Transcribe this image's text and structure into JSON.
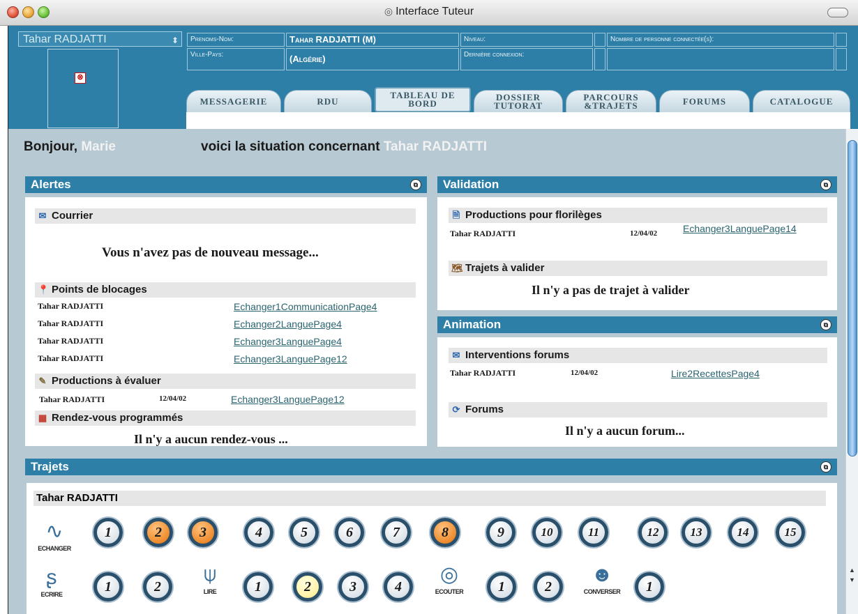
{
  "window": {
    "title": "Interface Tuteur"
  },
  "header": {
    "user_select": "Tahar RADJATTI",
    "labels": {
      "prenoms_nom": "Prenoms-Nom:",
      "ville_pays": "Ville-Pays:",
      "niveau": "Niveau:",
      "derniere_connexion": "Dernière connexion:",
      "nombre_connectees": "Nombre de personne connectée(s):"
    },
    "values": {
      "prenoms_nom": "Tahar RADJATTI (M)",
      "ville_pays": "(Algérie)"
    }
  },
  "tabs": [
    {
      "label": "MESSAGERIE"
    },
    {
      "label": "RDU"
    },
    {
      "label": "TABLEAU DE BORD",
      "active": true
    },
    {
      "label": "DOSSIER TUTORAT"
    },
    {
      "label": "PARCOURS &TRAJETS"
    },
    {
      "label": "FORUMS"
    },
    {
      "label": "CATALOGUE"
    }
  ],
  "greeting": {
    "bonjour": "Bonjour,",
    "tutor": "Marie",
    "situation": "voici la situation concernant",
    "student": "Tahar RADJATTI"
  },
  "alertes": {
    "title": "Alertes",
    "courrier": {
      "title": "Courrier",
      "message": "Vous n'avez pas de nouveau message..."
    },
    "blocages": {
      "title": "Points de blocages",
      "rows": [
        {
          "name": "Tahar RADJATTI",
          "link": "Echanger1CommunicationPage4"
        },
        {
          "name": "Tahar RADJATTI",
          "link": "Echanger2LanguePage4"
        },
        {
          "name": "Tahar RADJATTI",
          "link": "Echanger3LanguePage4"
        },
        {
          "name": "Tahar RADJATTI",
          "link": "Echanger3LanguePage12"
        }
      ]
    },
    "productions": {
      "title": "Productions à évaluer",
      "rows": [
        {
          "name": "Tahar RADJATTI",
          "date": "12/04/02",
          "link": "Echanger3LanguePage12"
        }
      ]
    },
    "rendezvous": {
      "title": "Rendez-vous programmés",
      "message": "Il n'y a aucun rendez-vous ..."
    }
  },
  "validation": {
    "title": "Validation",
    "florileges": {
      "title": "Productions pour florilèges",
      "rows": [
        {
          "name": "Tahar RADJATTI",
          "date": "12/04/02",
          "link": "Echanger3LanguePage14"
        }
      ]
    },
    "trajets": {
      "title": "Trajets à valider",
      "message": "Il n'y a pas de trajet à valider"
    }
  },
  "animation": {
    "title": "Animation",
    "interventions": {
      "title": "Interventions forums",
      "rows": [
        {
          "name": "Tahar RADJATTI",
          "date": "12/04/02",
          "link": "Lire2RecettesPage4"
        }
      ]
    },
    "forums": {
      "title": "Forums",
      "message": "Il n'y a aucun forum..."
    }
  },
  "trajets": {
    "title": "Trajets",
    "student": "Tahar RADJATTI",
    "skills": {
      "echanger": "ECHANGER",
      "ecrire": "ECRIRE",
      "lire": "LIRE",
      "ecouter": "ECOUTER",
      "converser": "CONVERSER"
    },
    "row1": [
      {
        "n": "1",
        "state": "normal"
      },
      {
        "n": "2",
        "state": "orange"
      },
      {
        "n": "3",
        "state": "orange"
      },
      {
        "n": "4",
        "state": "normal"
      },
      {
        "n": "5",
        "state": "normal"
      },
      {
        "n": "6",
        "state": "normal"
      },
      {
        "n": "7",
        "state": "normal"
      },
      {
        "n": "8",
        "state": "orange"
      },
      {
        "n": "9",
        "state": "normal"
      },
      {
        "n": "10",
        "state": "normal"
      },
      {
        "n": "11",
        "state": "normal"
      },
      {
        "n": "12",
        "state": "normal"
      },
      {
        "n": "13",
        "state": "normal"
      },
      {
        "n": "14",
        "state": "normal"
      },
      {
        "n": "15",
        "state": "normal"
      }
    ],
    "ecrire_steps": [
      {
        "n": "1",
        "state": "normal"
      },
      {
        "n": "2",
        "state": "normal"
      }
    ],
    "lire_steps": [
      {
        "n": "1",
        "state": "normal"
      },
      {
        "n": "2",
        "state": "yellow"
      },
      {
        "n": "3",
        "state": "normal"
      },
      {
        "n": "4",
        "state": "normal"
      }
    ],
    "ecouter_steps": [
      {
        "n": "1",
        "state": "normal"
      },
      {
        "n": "2",
        "state": "normal"
      }
    ],
    "converser_steps": [
      {
        "n": "1",
        "state": "normal"
      }
    ]
  }
}
